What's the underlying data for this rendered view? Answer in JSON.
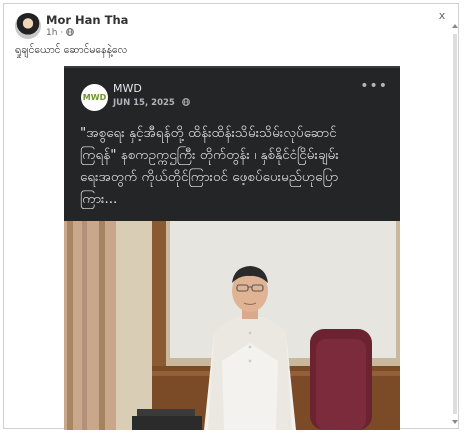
{
  "window": {
    "close_glyph": "x"
  },
  "post": {
    "author": "Mor Han Tha",
    "time": "1h",
    "audience_icon": "globe-icon",
    "caption": "ရှုချင်ယောင် ဆောင်မနေနဲ့လေ"
  },
  "shared_post": {
    "org_name": "MWD",
    "logo_text": "MWD",
    "date": "JUN 15, 2025",
    "more_glyph": "•••",
    "text_lines": [
      "\"အစွရေး နှင့်အီရန်တို့ ထိန်းထိန်းသိမ်းသိမ်းလုပ်ဆောင်",
      "ကြရန်\" နစကဥက္ကဌကြီး တိုက်တွန်း ၊ နှစ်နိုင်ငံငြိမ်းချမ်း",
      "ရေးအတွက် ကိုယ်တိုင်ကြားဝင် ဖေ့စပ်ပေးမည်ဟုပြော",
      "ကြား..."
    ]
  },
  "colors": {
    "shared_bg": "#242526",
    "shared_text": "#e4e6eb",
    "logo_green": "#6d9a29"
  }
}
